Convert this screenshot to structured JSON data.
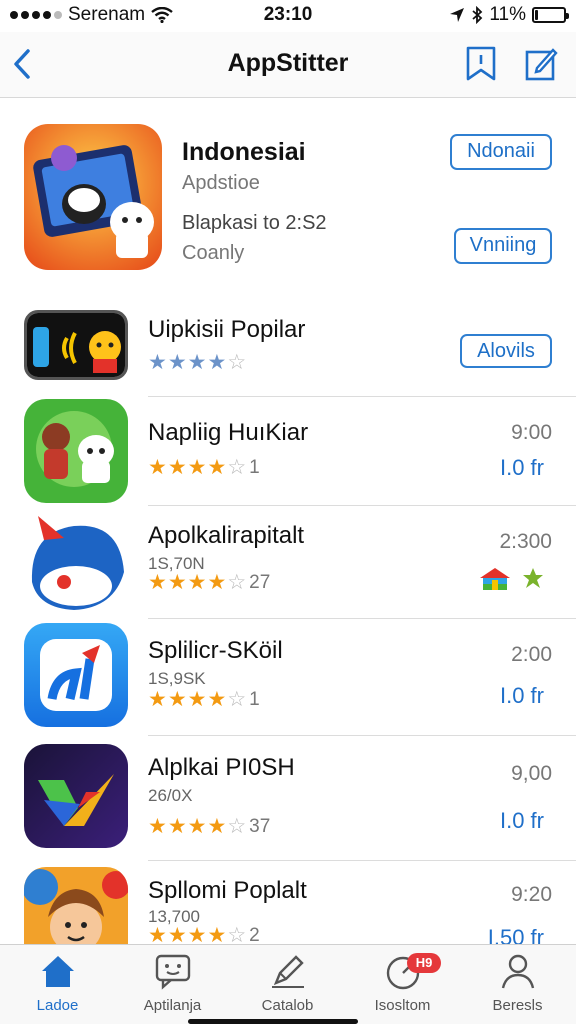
{
  "status_bar": {
    "carrier": "Serenam",
    "time": "23:10",
    "battery": "11%",
    "battery_level": 0.11
  },
  "nav": {
    "title": "AppStitter",
    "back_icon": "chevron-left-icon",
    "bookmark_icon": "bookmark-icon",
    "edit_icon": "edit-icon"
  },
  "featured": {
    "title": "Indonesiai",
    "subtitle": "Apdstioe",
    "line1": "Blapkasi to 2:S2",
    "line2": "Coanly",
    "button_top": "Ndonaii",
    "button_bottom": "Vnniing"
  },
  "apps": [
    {
      "title": "Uipkisii Popilar",
      "subtitle": "",
      "rating": 4,
      "star_style": "blue",
      "count": "",
      "price": "",
      "link": "",
      "button": "Alovils"
    },
    {
      "title": "Napliig HuıKiar",
      "subtitle": "",
      "rating": 4,
      "star_style": "gold",
      "count": "1",
      "price": "9:00",
      "link": "I.0 fr",
      "button": ""
    },
    {
      "title": "Apolkalirapitalt",
      "subtitle": "1S,70N",
      "rating": 4,
      "star_style": "gold",
      "count": "27",
      "price": "2:300",
      "link": "",
      "button": ""
    },
    {
      "title": "Splilicr-SKöil",
      "subtitle": "1S,9SK",
      "rating": 4,
      "star_style": "gold",
      "count": "1",
      "price": "2:00",
      "link": "I.0 fr",
      "button": ""
    },
    {
      "title": "Alplkai PI0SH",
      "subtitle": "26/0X",
      "rating": 4,
      "star_style": "gold",
      "count": "37",
      "price": "9,00",
      "link": "I.0 fr",
      "button": ""
    },
    {
      "title": "Spllomi Poplalt",
      "subtitle": "13,700",
      "rating": 4,
      "star_style": "gold",
      "count": "2",
      "price": "9:20",
      "link": "I.50 fr",
      "button": ""
    }
  ],
  "tabs": [
    {
      "label": "Ladoe",
      "icon": "home-icon",
      "active": true
    },
    {
      "label": "Aptilanja",
      "icon": "chat-icon",
      "active": false
    },
    {
      "label": "Catalob",
      "icon": "pencil-icon",
      "active": false
    },
    {
      "label": "Isosltom",
      "icon": "updates-icon",
      "active": false,
      "badge": "H9"
    },
    {
      "label": "Beresls",
      "icon": "person-icon",
      "active": false
    }
  ],
  "colors": {
    "accent": "#1f6fc9",
    "star": "#f39a12",
    "badge": "#e5383b"
  }
}
